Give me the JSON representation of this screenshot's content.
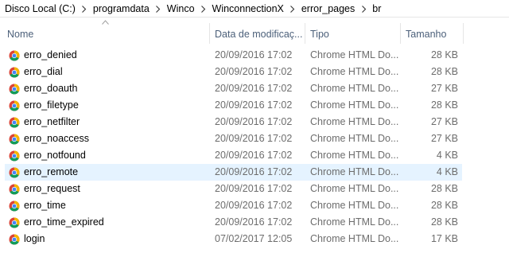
{
  "breadcrumb": [
    "Disco Local (C:)",
    "programdata",
    "Winco",
    "WinconnectionX",
    "error_pages",
    "br"
  ],
  "columns": {
    "name": "Nome",
    "date": "Data de modificaç...",
    "type": "Tipo",
    "size": "Tamanho"
  },
  "files": [
    {
      "name": "erro_denied",
      "date": "20/09/2016 17:02",
      "type": "Chrome HTML Do...",
      "size": "28 KB",
      "selected": false
    },
    {
      "name": "erro_dial",
      "date": "20/09/2016 17:02",
      "type": "Chrome HTML Do...",
      "size": "28 KB",
      "selected": false
    },
    {
      "name": "erro_doauth",
      "date": "20/09/2016 17:02",
      "type": "Chrome HTML Do...",
      "size": "27 KB",
      "selected": false
    },
    {
      "name": "erro_filetype",
      "date": "20/09/2016 17:02",
      "type": "Chrome HTML Do...",
      "size": "28 KB",
      "selected": false
    },
    {
      "name": "erro_netfilter",
      "date": "20/09/2016 17:02",
      "type": "Chrome HTML Do...",
      "size": "27 KB",
      "selected": false
    },
    {
      "name": "erro_noaccess",
      "date": "20/09/2016 17:02",
      "type": "Chrome HTML Do...",
      "size": "27 KB",
      "selected": false
    },
    {
      "name": "erro_notfound",
      "date": "20/09/2016 17:02",
      "type": "Chrome HTML Do...",
      "size": "4 KB",
      "selected": false
    },
    {
      "name": "erro_remote",
      "date": "20/09/2016 17:02",
      "type": "Chrome HTML Do...",
      "size": "4 KB",
      "selected": true
    },
    {
      "name": "erro_request",
      "date": "20/09/2016 17:02",
      "type": "Chrome HTML Do...",
      "size": "28 KB",
      "selected": false
    },
    {
      "name": "erro_time",
      "date": "20/09/2016 17:02",
      "type": "Chrome HTML Do...",
      "size": "28 KB",
      "selected": false
    },
    {
      "name": "erro_time_expired",
      "date": "20/09/2016 17:02",
      "type": "Chrome HTML Do...",
      "size": "28 KB",
      "selected": false
    },
    {
      "name": "login",
      "date": "07/02/2017 12:05",
      "type": "Chrome HTML Do...",
      "size": "17 KB",
      "selected": false
    }
  ],
  "icons": {
    "file": "chrome-icon",
    "separator": "chevron-right-icon",
    "sort": "sort-ascending-icon"
  },
  "colors": {
    "selection": "#e5f3ff",
    "header_text": "#4c607a",
    "secondary_text": "#6d6d6d"
  }
}
